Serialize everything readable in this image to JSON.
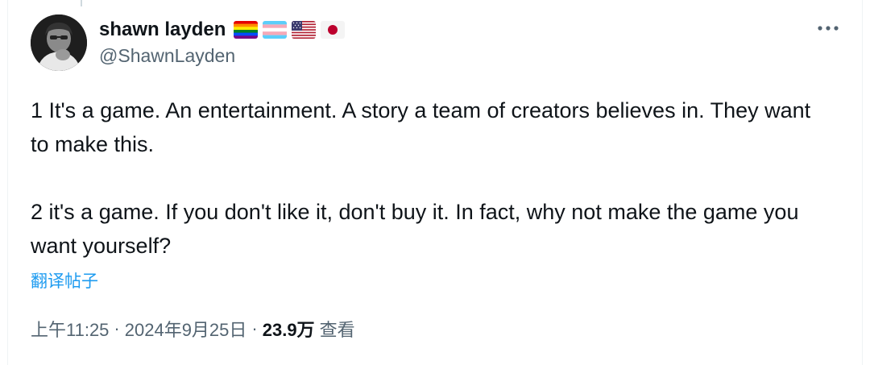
{
  "author": {
    "display_name": "shawn layden",
    "handle": "@ShawnLayden",
    "flags": [
      "rainbow-pride-flag-icon",
      "transgender-flag-icon",
      "us-flag-icon",
      "japan-flag-icon"
    ]
  },
  "tweet": {
    "paragraph_1": "1 It's a game. An entertainment. A story a team of creators believes in. They want to make this.",
    "paragraph_2": "2 it's a game. If you don't like it, don't buy it. In fact, why not make the game you want yourself?",
    "translate_label": "翻译帖子"
  },
  "meta": {
    "time": "上午11:25",
    "separator": "·",
    "date": "2024年9月25日",
    "views_count": "23.9万",
    "views_label": "查看"
  },
  "colors": {
    "text_primary": "#0f1419",
    "text_secondary": "#536471",
    "link": "#1d9bf0"
  }
}
